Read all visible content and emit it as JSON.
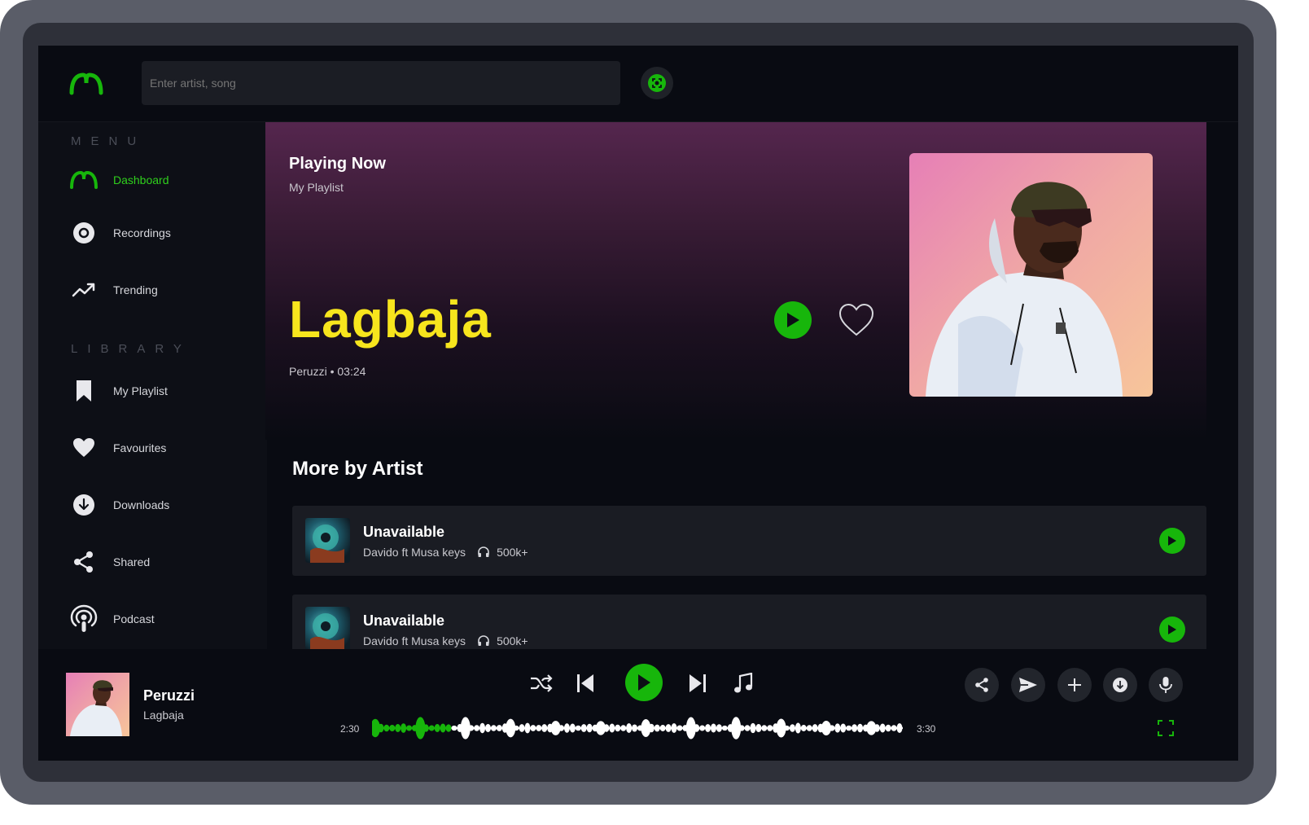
{
  "search": {
    "placeholder": "Enter artist, song"
  },
  "sidebar": {
    "menu_title": "MENU",
    "menu_items": [
      {
        "label": "Dashboard",
        "icon": "logo-icon",
        "active": true
      },
      {
        "label": "Recordings",
        "icon": "disc-icon"
      },
      {
        "label": "Trending",
        "icon": "trending-icon"
      }
    ],
    "library_title": "LIBRARY",
    "library_items": [
      {
        "label": "My Playlist",
        "icon": "bookmark-icon"
      },
      {
        "label": "Favourites",
        "icon": "heart-icon"
      },
      {
        "label": "Downloads",
        "icon": "download-icon"
      },
      {
        "label": "Shared",
        "icon": "share-icon"
      },
      {
        "label": "Podcast",
        "icon": "podcast-icon"
      }
    ]
  },
  "hero": {
    "heading": "Playing Now",
    "subheading": "My Playlist",
    "song_title": "Lagbaja",
    "artist": "Peruzzi",
    "duration": "03:24"
  },
  "more": {
    "title": "More by Artist",
    "tracks": [
      {
        "title": "Unavailable",
        "artist": "Davido ft Musa keys",
        "listens": "500k+"
      },
      {
        "title": "Unavailable",
        "artist": "Davido ft Musa keys",
        "listens": "500k+"
      }
    ]
  },
  "player": {
    "artist": "Peruzzi",
    "song": "Lagbaja",
    "elapsed": "2:30",
    "total": "3:30",
    "progress": 0.15
  },
  "colors": {
    "accent": "#17b60b",
    "active_text": "#2fcf1c",
    "title_yellow": "#f7e51d",
    "background": "#090b12"
  }
}
